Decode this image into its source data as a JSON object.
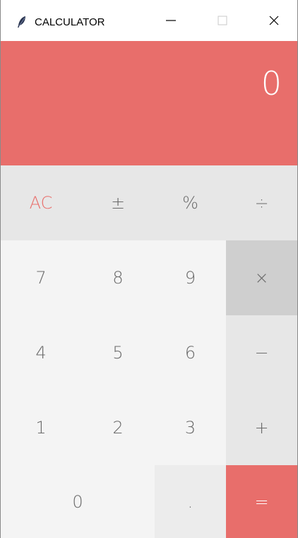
{
  "window": {
    "title": "CALCULATOR",
    "minimize_label": "—",
    "maximize_label": "□",
    "close_label": "✕"
  },
  "display": {
    "value": "0"
  },
  "keys": {
    "ac": "AC",
    "plus_minus": "±",
    "percent": "%",
    "divide": "÷",
    "seven": "7",
    "eight": "8",
    "nine": "9",
    "multiply": "×",
    "four": "4",
    "five": "5",
    "six": "6",
    "minus": "−",
    "one": "1",
    "two": "2",
    "three": "3",
    "plus": "+",
    "zero": "0",
    "dot": ".",
    "equals": "="
  },
  "colors": {
    "accent": "#e86e6b",
    "active_operator": "#cfcfcf"
  },
  "icons": {
    "app": "feather-icon"
  }
}
